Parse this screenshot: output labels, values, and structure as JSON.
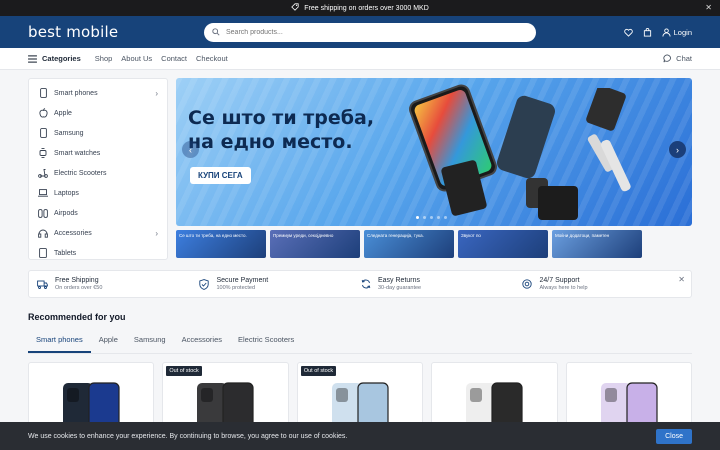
{
  "topbar": {
    "message": "Free shipping on orders over 3000 MKD"
  },
  "header": {
    "logo": "best mobile",
    "search_placeholder": "Search products...",
    "login_label": "Login"
  },
  "nav": {
    "categories_label": "Categories",
    "links": [
      "Shop",
      "About Us",
      "Contact",
      "Checkout"
    ],
    "chat_label": "Chat"
  },
  "sidebar": {
    "items": [
      {
        "label": "Smart phones",
        "icon": "phone-icon",
        "has_children": true
      },
      {
        "label": "Apple",
        "icon": "apple-icon",
        "has_children": false
      },
      {
        "label": "Samsung",
        "icon": "phone-icon",
        "has_children": false
      },
      {
        "label": "Smart watches",
        "icon": "watch-icon",
        "has_children": false
      },
      {
        "label": "Electric Scooters",
        "icon": "scooter-icon",
        "has_children": false
      },
      {
        "label": "Laptops",
        "icon": "laptop-icon",
        "has_children": false
      },
      {
        "label": "Airpods",
        "icon": "airpods-icon",
        "has_children": false
      },
      {
        "label": "Accessories",
        "icon": "accessories-icon",
        "has_children": true
      },
      {
        "label": "Tablets",
        "icon": "tablet-icon",
        "has_children": false
      }
    ]
  },
  "hero": {
    "headline_line1": "Се што ти треба,",
    "headline_line2": "на едно место.",
    "cta_label": "КУПИ СЕГА",
    "slide_count": 5,
    "active_slide": 0
  },
  "thumbnails": [
    {
      "text": "Се што ти треба, на едно место.",
      "color": "#3d7fe0"
    },
    {
      "text": "Премиум уреди, секојдневно",
      "color": "#5a6fb8"
    },
    {
      "text": "Следната генерација, тука.",
      "color": "#4a8fd8"
    },
    {
      "text": "Звукот по",
      "color": "#3a66c0"
    },
    {
      "text": "Моќни додатоци, паметен",
      "color": "#6b9fe0"
    }
  ],
  "benefits": [
    {
      "title": "Free Shipping",
      "subtitle": "On orders over €50",
      "icon": "truck-icon"
    },
    {
      "title": "Secure Payment",
      "subtitle": "100% protected",
      "icon": "shield-icon"
    },
    {
      "title": "Easy Returns",
      "subtitle": "30-day guarantee",
      "icon": "refresh-icon"
    },
    {
      "title": "24/7 Support",
      "subtitle": "Always here to help",
      "icon": "headset-icon"
    }
  ],
  "recommended": {
    "title": "Recommended for you",
    "tabs": [
      "Smart phones",
      "Apple",
      "Samsung",
      "Accessories",
      "Electric Scooters"
    ],
    "active_tab": 0,
    "products": [
      {
        "badge": "",
        "color": "#1f2937",
        "screen": "#1b3a8f"
      },
      {
        "badge": "Out of stock",
        "color": "#3a3a3c",
        "screen": "#2c2c2e"
      },
      {
        "badge": "Out of stock",
        "color": "#cfe0ee",
        "screen": "#a8c6e0"
      },
      {
        "badge": "",
        "color": "#eeeeee",
        "screen": "#2a2a2a"
      },
      {
        "badge": "",
        "color": "#e0d4f0",
        "screen": "#c8b0e8"
      }
    ]
  },
  "cookie": {
    "message": "We use cookies to enhance your experience. By continuing to browse, you agree to our use of cookies.",
    "close_label": "Close"
  },
  "colors": {
    "brand": "#17437a",
    "accent": "#2f73c9",
    "topbar": "#1b1b1d"
  }
}
